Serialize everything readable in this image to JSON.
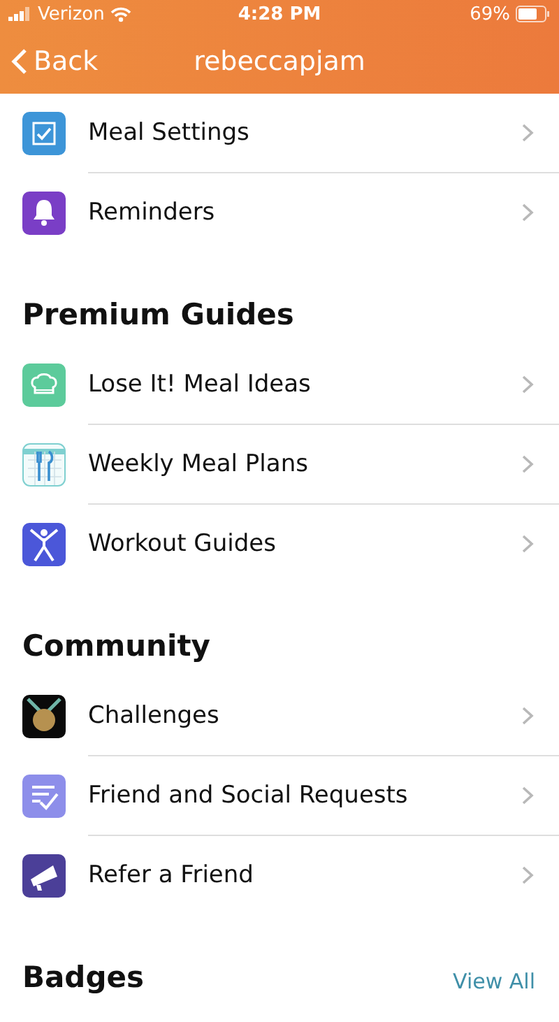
{
  "status_bar": {
    "carrier": "Verizon",
    "time": "4:28 PM",
    "battery": "69%"
  },
  "nav": {
    "back": "Back",
    "title": "rebeccapjam"
  },
  "sections": [
    {
      "items": [
        {
          "label": "Meal Settings",
          "kind": "checkbox"
        },
        {
          "label": "Reminders",
          "kind": "bell"
        }
      ]
    },
    {
      "title": "Premium Guides",
      "items": [
        {
          "label": "Lose It! Meal Ideas",
          "kind": "chef"
        },
        {
          "label": "Weekly Meal Plans",
          "kind": "plans"
        },
        {
          "label": "Workout Guides",
          "kind": "workout"
        }
      ]
    },
    {
      "title": "Community",
      "items": [
        {
          "label": "Challenges",
          "kind": "medal"
        },
        {
          "label": "Friend and Social Requests",
          "kind": "requests"
        },
        {
          "label": "Refer a Friend",
          "kind": "megaphone"
        }
      ]
    },
    {
      "title": "Badges",
      "action": "View All"
    }
  ]
}
